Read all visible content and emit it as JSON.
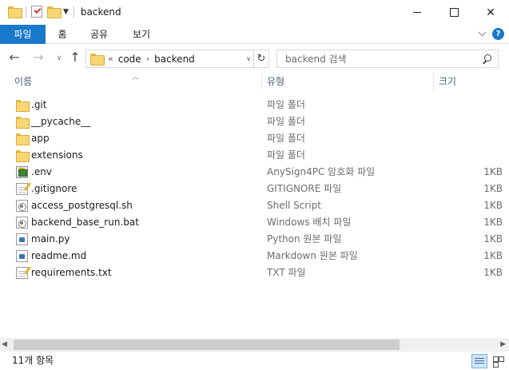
{
  "window": {
    "title": "backend"
  },
  "ribbon": {
    "tabs": [
      "파일",
      "홈",
      "공유",
      "보기"
    ],
    "help_label": "?"
  },
  "address": {
    "overflow": "«",
    "breadcrumbs": [
      "code",
      "backend"
    ]
  },
  "search": {
    "placeholder": "backend 검색"
  },
  "columns": {
    "name": "이름",
    "type": "유형",
    "size": "크기"
  },
  "files": [
    {
      "name": ".git",
      "type": "파일 폴더",
      "size": "",
      "icon": "folder-icon"
    },
    {
      "name": "__pycache__",
      "type": "파일 폴더",
      "size": "",
      "icon": "folder-icon"
    },
    {
      "name": "app",
      "type": "파일 폴더",
      "size": "",
      "icon": "folder-icon"
    },
    {
      "name": "extensions",
      "type": "파일 폴더",
      "size": "",
      "icon": "folder-icon"
    },
    {
      "name": ".env",
      "type": "AnySign4PC 암호화 파일",
      "size": "1KB",
      "icon": "anysign-file-icon"
    },
    {
      "name": ".gitignore",
      "type": "GITIGNORE 파일",
      "size": "1KB",
      "icon": "notepad-file-icon"
    },
    {
      "name": "access_postgresql.sh",
      "type": "Shell Script",
      "size": "1KB",
      "icon": "script-file-icon"
    },
    {
      "name": "backend_base_run.bat",
      "type": "Windows 배치 파일",
      "size": "1KB",
      "icon": "script-file-icon"
    },
    {
      "name": "main.py",
      "type": "Python 원본 파일",
      "size": "1KB",
      "icon": "python-file-icon"
    },
    {
      "name": "readme.md",
      "type": "Markdown 원본 파일",
      "size": "1KB",
      "icon": "markdown-file-icon"
    },
    {
      "name": "requirements.txt",
      "type": "TXT 파일",
      "size": "1KB",
      "icon": "notepad-file-icon"
    }
  ],
  "status": {
    "item_count": "11개 항목"
  },
  "colors": {
    "accent": "#1979ca",
    "folder": "#f7d674",
    "header_text": "#4c607a"
  }
}
